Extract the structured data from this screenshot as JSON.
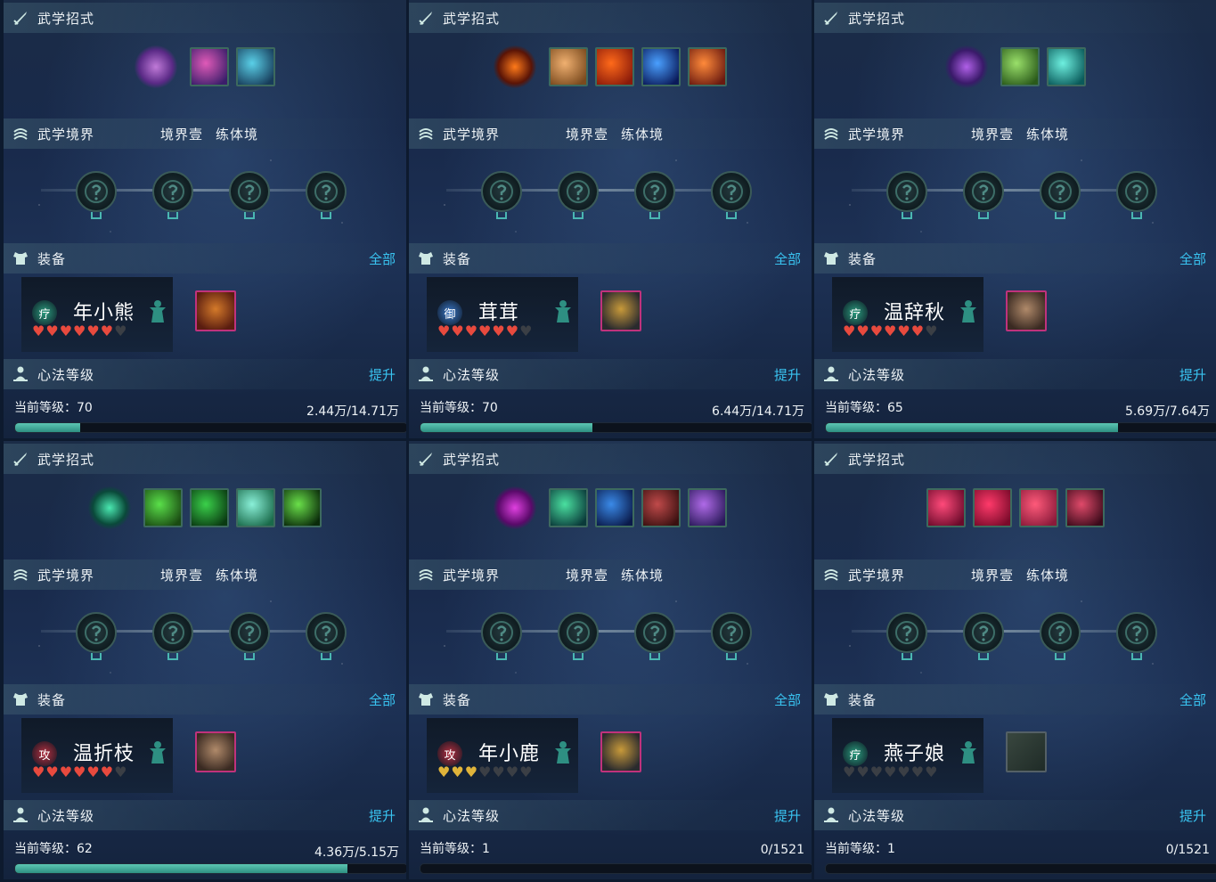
{
  "labels": {
    "skills_title": "武学招式",
    "realm_title": "武学境界",
    "realm_level": "境界壹",
    "realm_stage": "练体境",
    "equip_title": "装备",
    "equip_all": "全部",
    "mind_title": "心法等级",
    "mind_upgrade": "提升",
    "level_prefix": "当前等级："
  },
  "colors": {
    "accent_link": "#39c3f0",
    "progress_fill": "#3fae9e",
    "heart_red": "#e84a3e",
    "heart_gold": "#e0b43a",
    "heart_empty": "#3b3f45",
    "gear_border": "#c0327c"
  },
  "panels": [
    {
      "skills": [
        {
          "icon": "purple-cone-skill-icon",
          "colors": [
            "#c07ad8",
            "#5a2a86"
          ],
          "main": true
        },
        {
          "icon": "pink-dancer-skill-icon",
          "colors": [
            "#e05ab8",
            "#3a1e6a"
          ]
        },
        {
          "icon": "teal-fan-skill-icon",
          "colors": [
            "#5ad0e8",
            "#173c5a"
          ]
        }
      ],
      "equip": {
        "role": "疗",
        "role_color": "#2b9c7e",
        "name": "年小熊",
        "hearts": [
          "red",
          "red",
          "red",
          "red",
          "red",
          "red",
          "empty"
        ],
        "gear_colors": [
          "#d47a2a",
          "#5a1d10"
        ],
        "gear_icon": "orange-armor-icon",
        "gear_empty": false
      },
      "level": "70",
      "exp": "2.44万/14.71万",
      "progress": 0.166
    },
    {
      "skills": [
        {
          "icon": "fire-figure-skill-icon",
          "colors": [
            "#ff7a1a",
            "#5a1406"
          ],
          "main": true
        },
        {
          "icon": "golden-face-skill-icon",
          "colors": [
            "#f0b070",
            "#7a4a1e"
          ]
        },
        {
          "icon": "fire-burst-skill-icon",
          "colors": [
            "#ff6a1a",
            "#8a1a0a"
          ]
        },
        {
          "icon": "blue-crescent-skill-icon",
          "colors": [
            "#4aa0ff",
            "#0a1a5a"
          ]
        },
        {
          "icon": "fire-swirl-skill-icon",
          "colors": [
            "#ff8a3a",
            "#6a1a10"
          ]
        }
      ],
      "equip": {
        "role": "御",
        "role_color": "#3a78c8",
        "name": "茸茸",
        "hearts": [
          "red",
          "red",
          "red",
          "red",
          "red",
          "red",
          "empty"
        ],
        "gear_colors": [
          "#c89a3a",
          "#2a2a2e"
        ],
        "gear_icon": "dark-armor-icon",
        "gear_empty": false
      },
      "level": "70",
      "exp": "6.44万/14.71万",
      "progress": 0.438
    },
    {
      "skills": [
        {
          "icon": "violet-figure-skill-icon",
          "colors": [
            "#b060e8",
            "#3a1a6a"
          ],
          "main": true
        },
        {
          "icon": "green-hands-skill-icon",
          "colors": [
            "#9ae06a",
            "#2a5a1a"
          ]
        },
        {
          "icon": "cyan-spiral-skill-icon",
          "colors": [
            "#6ef0e0",
            "#0a5a5a"
          ]
        }
      ],
      "equip": {
        "role": "疗",
        "role_color": "#2b9c7e",
        "name": "温辞秋",
        "hearts": [
          "red",
          "red",
          "red",
          "red",
          "red",
          "red",
          "empty"
        ],
        "gear_colors": [
          "#b08a6a",
          "#3a2a22"
        ],
        "gear_icon": "robe-armor-icon",
        "gear_empty": false
      },
      "level": "65",
      "exp": "5.69万/7.64万",
      "progress": 0.745
    },
    {
      "skills": [
        {
          "icon": "green-aura-skill-icon",
          "colors": [
            "#4ae8b0",
            "#0a4a3a"
          ],
          "main": true
        },
        {
          "icon": "green-slash-skill-icon",
          "colors": [
            "#5ae04a",
            "#1a4a12"
          ]
        },
        {
          "icon": "green-leaf-skill-icon",
          "colors": [
            "#3ad04a",
            "#0a3a12"
          ]
        },
        {
          "icon": "green-ring-skill-icon",
          "colors": [
            "#8af0d8",
            "#1a6a4a"
          ]
        },
        {
          "icon": "yin-yang-skill-icon",
          "colors": [
            "#6ae04a",
            "#0a2a0a"
          ]
        }
      ],
      "equip": {
        "role": "攻",
        "role_color": "#b53040",
        "name": "温折枝",
        "hearts": [
          "red",
          "red",
          "red",
          "red",
          "red",
          "red",
          "empty"
        ],
        "gear_colors": [
          "#b08a6a",
          "#3a2a22"
        ],
        "gear_icon": "robe-armor-icon",
        "gear_empty": false
      },
      "level": "62",
      "exp": "4.36万/5.15万",
      "progress": 0.847
    },
    {
      "skills": [
        {
          "icon": "magenta-sigil-skill-icon",
          "colors": [
            "#e040e0",
            "#5a0a6a"
          ],
          "main": true
        },
        {
          "icon": "green-star-skill-icon",
          "colors": [
            "#4ae0a0",
            "#0a3a3a"
          ]
        },
        {
          "icon": "blue-serpent-skill-icon",
          "colors": [
            "#3a8ae8",
            "#0a1a4a"
          ]
        },
        {
          "icon": "crimson-dragon-skill-icon",
          "colors": [
            "#c04a4a",
            "#3a1010"
          ]
        },
        {
          "icon": "purple-dancer-skill-icon",
          "colors": [
            "#b06ae8",
            "#2a1a5a"
          ]
        }
      ],
      "equip": {
        "role": "攻",
        "role_color": "#b53040",
        "name": "年小鹿",
        "hearts": [
          "gold",
          "gold",
          "gold",
          "empty",
          "empty",
          "empty",
          "empty"
        ],
        "gear_colors": [
          "#c89a3a",
          "#2a2a2e"
        ],
        "gear_icon": "gold-armor-icon",
        "gear_empty": false
      },
      "level": "1",
      "exp": "0/1521",
      "progress": 0
    },
    {
      "skills": [
        {
          "icon": "red-claw-skill-icon",
          "colors": [
            "#ff4a7a",
            "#6a0a2a"
          ],
          "main": false
        },
        {
          "icon": "red-slash-skill-icon",
          "colors": [
            "#ff3a6a",
            "#7a0a2a"
          ]
        },
        {
          "icon": "rose-skill-icon",
          "colors": [
            "#ff5a7a",
            "#8a1a3a"
          ]
        },
        {
          "icon": "red-figure-skill-icon",
          "colors": [
            "#e04a6a",
            "#3a0a1a"
          ]
        }
      ],
      "equip": {
        "role": "疗",
        "role_color": "#2b9c7e",
        "name": "燕子娘",
        "hearts": [
          "empty",
          "empty",
          "empty",
          "empty",
          "empty",
          "empty",
          "empty"
        ],
        "gear_colors": [
          "#4a5a52",
          "#1f2b27"
        ],
        "gear_icon": "empty-armor-slot-icon",
        "gear_empty": true
      },
      "level": "1",
      "exp": "0/1521",
      "progress": 0
    }
  ]
}
